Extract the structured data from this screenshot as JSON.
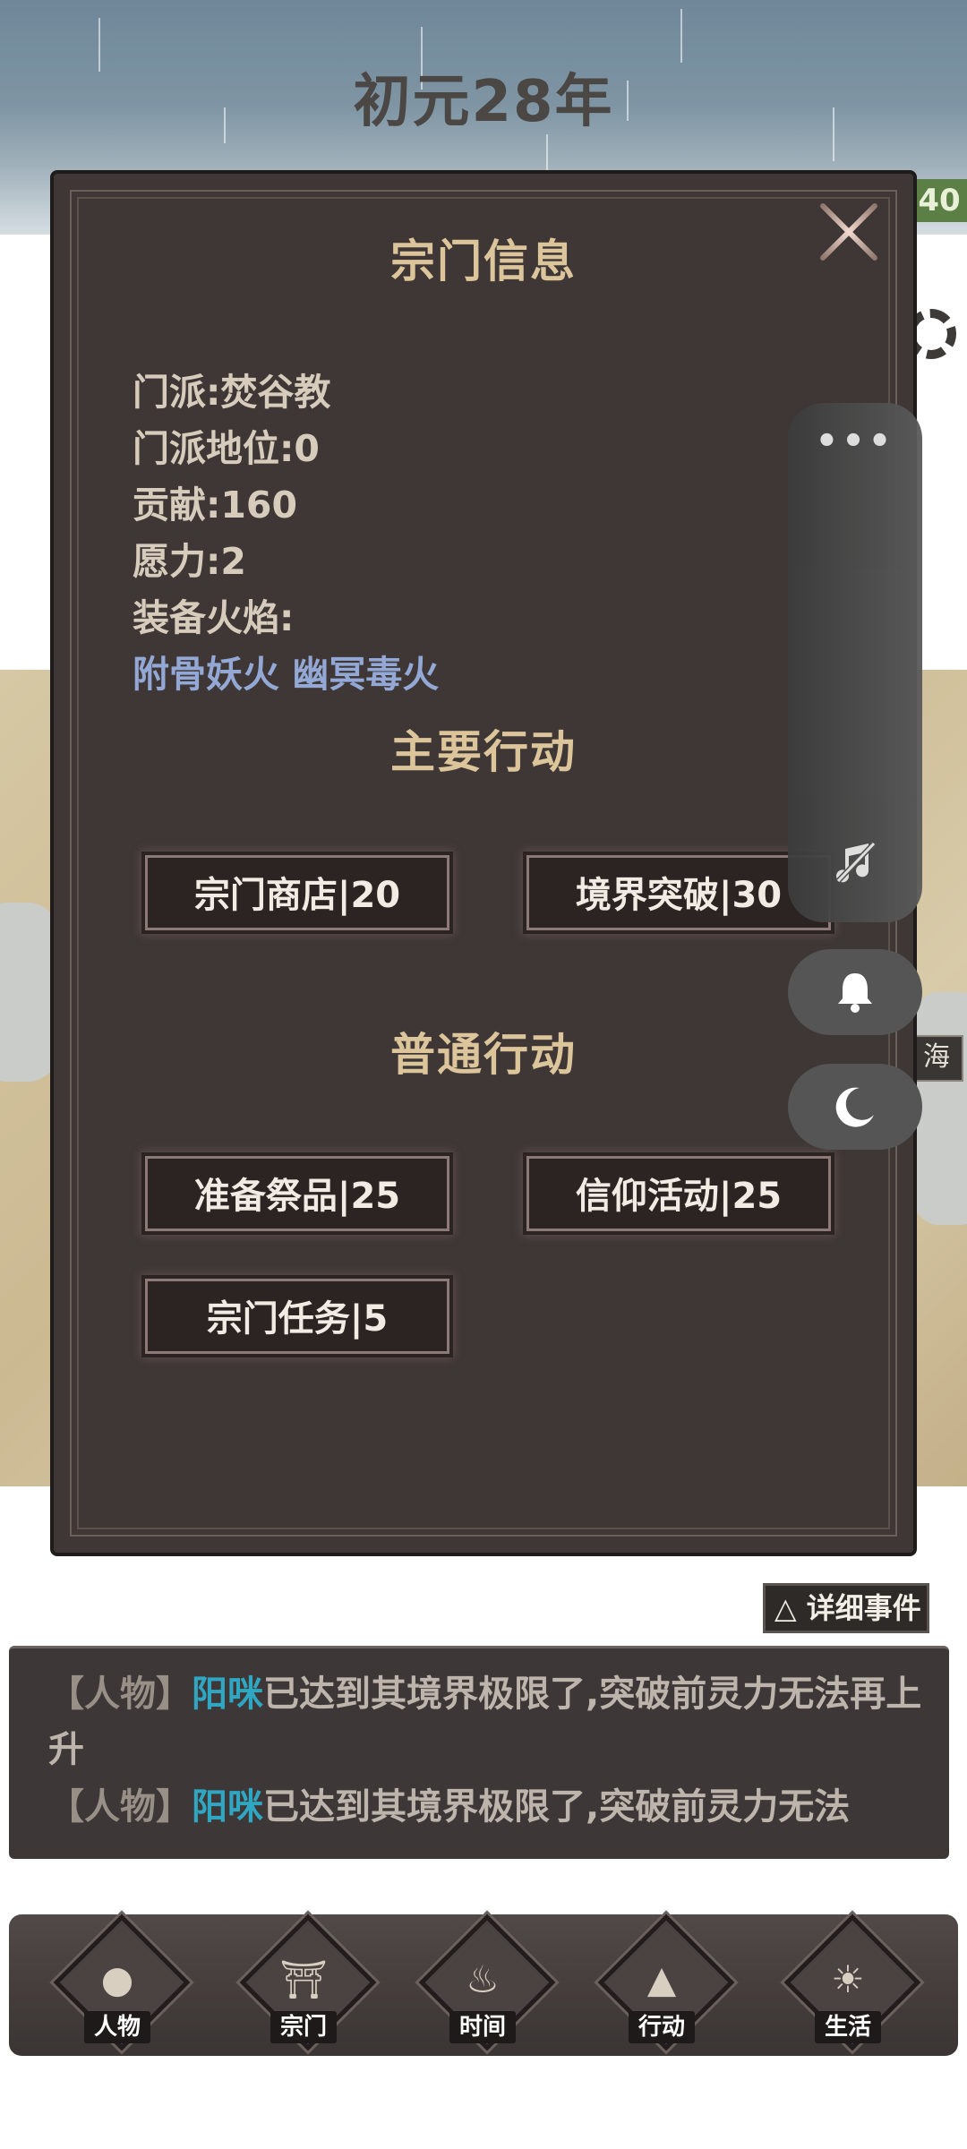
{
  "header": {
    "year_title": "初元28年",
    "corner_number": "40"
  },
  "map": {
    "tag": "海"
  },
  "modal": {
    "title": "宗门信息",
    "info": {
      "sect": "门派:焚谷教",
      "status": "门派地位:0",
      "contribution": "贡献:160",
      "will": "愿力:2",
      "equipped_label": "装备火焰:",
      "equipped_flames": "附骨妖火 幽冥毒火"
    },
    "main_section_title": "主要行动",
    "main_actions": [
      "宗门商店|20",
      "境界突破|30"
    ],
    "normal_section_title": "普通行动",
    "normal_actions": [
      "准备祭品|25",
      "信仰活动|25",
      "宗门任务|5"
    ]
  },
  "side_menu": {
    "more_icon": "more-horizontal-icon",
    "music_icon": "music-off-icon",
    "bell_icon": "bell-icon",
    "theme_icon": "moon-icon"
  },
  "events": {
    "detail_button": "△ 详细事件",
    "lines": [
      {
        "tag": "【人物】",
        "name": "阳咪",
        "text": "已达到其境界极限了,突破前灵力无法再上升"
      },
      {
        "tag": "【人物】",
        "name": "阳咪",
        "text": "已达到其境界极限了,突破前灵力无法"
      }
    ]
  },
  "nav": {
    "items": [
      {
        "label": "人物",
        "icon": "person-icon"
      },
      {
        "label": "宗门",
        "icon": "gate-icon"
      },
      {
        "label": "时间",
        "icon": "incense-icon"
      },
      {
        "label": "行动",
        "icon": "action-icon"
      },
      {
        "label": "生活",
        "icon": "field-icon"
      }
    ]
  },
  "colors": {
    "modal_bg": "#3e3736",
    "title_gold": "#dcc59b",
    "flame_blue": "#94a8d6",
    "name_cyan": "#2fa7c2"
  }
}
